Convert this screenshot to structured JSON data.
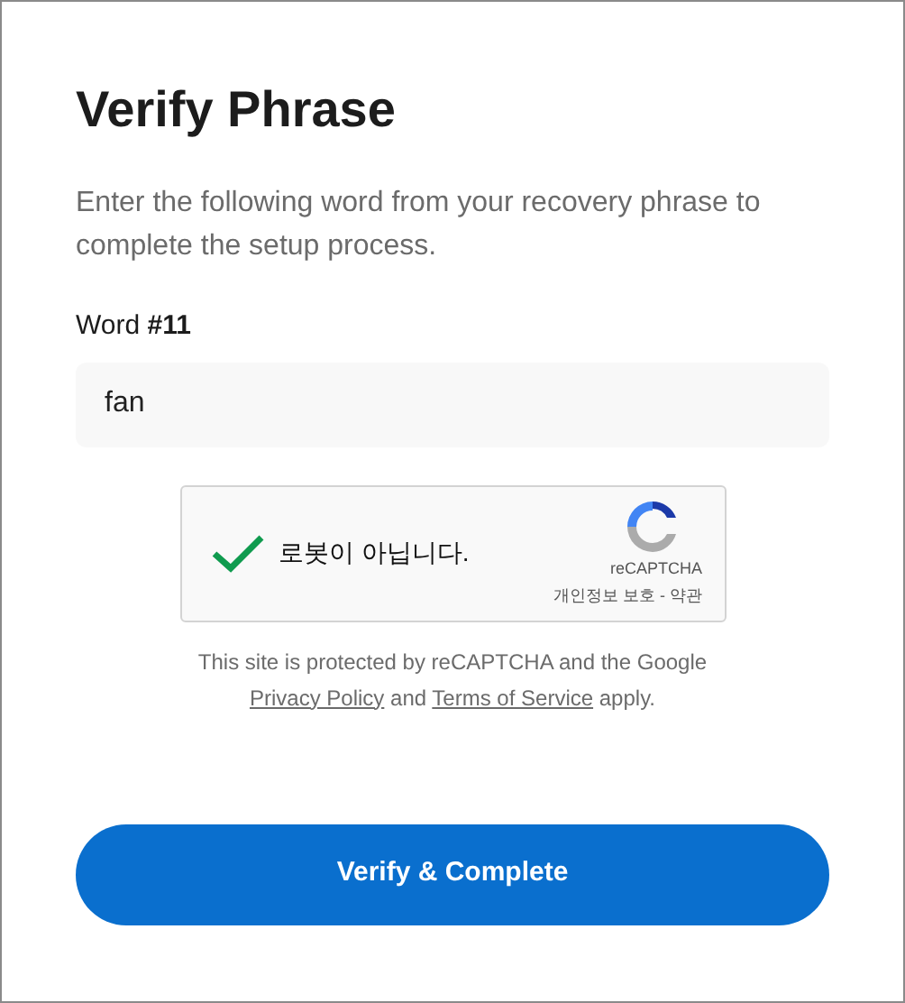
{
  "title": "Verify Phrase",
  "description": "Enter the following word from your recovery phrase to complete the setup process.",
  "word_label": "Word **#11**",
  "word_field": {
    "value": "fan"
  },
  "captcha": {
    "checked": true,
    "label": "로봇이 아닙니다.",
    "brand": "reCAPTCHA",
    "links": "개인정보 보호 - 약관"
  },
  "notice": {
    "before": "This site is protected by reCAPTCHA and the Google",
    "link_1": "Privacy Policy",
    "middle": "and",
    "link_2": "Terms of Service",
    "after": "apply."
  },
  "submit_button": "Verify & Complete"
}
